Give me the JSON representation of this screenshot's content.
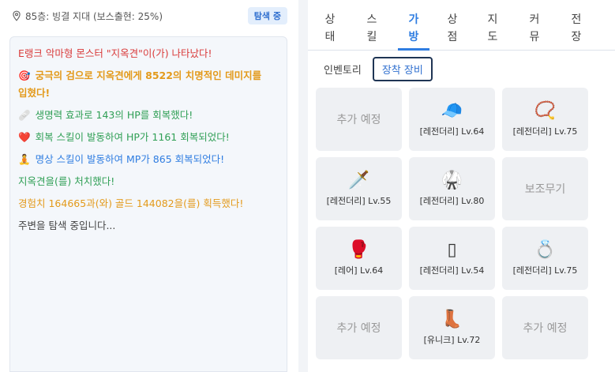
{
  "location": {
    "text": "85층: 빙결 지대 (보스출현: 25%)",
    "status": "탐색 중"
  },
  "log": [
    {
      "emoji": "",
      "text": "E랭크 악마형 몬스터 \"지옥견\"이(가) 나타났다!",
      "color": "#d93a3a",
      "bold": false
    },
    {
      "emoji": "🎯",
      "text": "궁극의 검으로 지옥견에게 8522의 치명적인 데미지를 입혔다!",
      "color": "#e39a1b",
      "bold": true
    },
    {
      "emoji": "🩹",
      "text": "생명력 효과로 143의 HP를 회복했다!",
      "color": "#2f9f55",
      "bold": false
    },
    {
      "emoji": "❤️",
      "text": "회복 스킬이 발동하여 HP가 1161 회복되었다!",
      "color": "#2f9f55",
      "bold": false
    },
    {
      "emoji": "🧘",
      "text": "명상 스킬이 발동하여 MP가 865 회복되었다!",
      "color": "#2f7de1",
      "bold": false
    },
    {
      "emoji": "",
      "text": "지옥견을(를) 처치했다!",
      "color": "#2f9f55",
      "bold": false
    },
    {
      "emoji": "",
      "text": "경험치 164665과(와) 골드 144082을(를) 획득했다!",
      "color": "#e39a1b",
      "bold": false
    },
    {
      "emoji": "",
      "text": "주변을 탐색 중입니다...",
      "color": "#444444",
      "bold": false
    }
  ],
  "tabs": [
    {
      "label": "상\n태",
      "active": false
    },
    {
      "label": "스\n킬",
      "active": false
    },
    {
      "label": "가\n방",
      "active": true
    },
    {
      "label": "상\n점",
      "active": false
    },
    {
      "label": "지\n도",
      "active": false
    },
    {
      "label": "커\n뮤",
      "active": false
    },
    {
      "label": "전\n장",
      "active": false
    }
  ],
  "subtabs": [
    {
      "label": "인벤토리",
      "active": false
    },
    {
      "label": "장착 장비",
      "active": true
    }
  ],
  "equipment": [
    {
      "empty": true,
      "placeholder": "추가 예정"
    },
    {
      "empty": false,
      "icon": "🧢",
      "icon_name": "cap-icon",
      "label": "[레전더리] Lv.64"
    },
    {
      "empty": false,
      "icon": "📿",
      "icon_name": "amulet-icon",
      "label": "[레전더리] Lv.75"
    },
    {
      "empty": false,
      "icon": "🗡️",
      "icon_name": "sword-icon",
      "label": "[레전더리] Lv.55"
    },
    {
      "empty": false,
      "icon": "🥋",
      "icon_name": "armor-icon",
      "label": "[레전더리] Lv.80"
    },
    {
      "empty": true,
      "placeholder": "보조무기"
    },
    {
      "empty": false,
      "icon": "🥊",
      "icon_name": "glove-icon",
      "label": "[레어] Lv.64"
    },
    {
      "empty": false,
      "icon": "▯",
      "icon_name": "missing-glyph-icon",
      "label": "[레전더리] Lv.54"
    },
    {
      "empty": false,
      "icon": "💍",
      "icon_name": "ring-icon",
      "label": "[레전더리] Lv.75"
    },
    {
      "empty": true,
      "placeholder": "추가 예정"
    },
    {
      "empty": false,
      "icon": "👢",
      "icon_name": "boot-icon",
      "label": "[유니크] Lv.72"
    },
    {
      "empty": true,
      "placeholder": "추가 예정"
    }
  ],
  "colors": {
    "accent": "#2f7de1",
    "danger": "#d93a3a",
    "success": "#2f9f55",
    "warning": "#e39a1b"
  }
}
